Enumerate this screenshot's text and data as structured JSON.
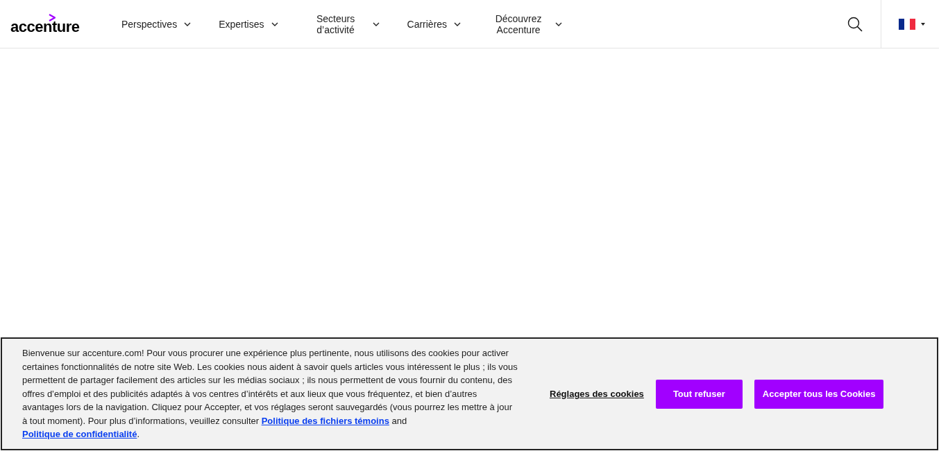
{
  "header": {
    "logo": "accenture",
    "nav": [
      {
        "label": "Perspectives"
      },
      {
        "label": "Expertises"
      },
      {
        "label": "Secteurs d’activité"
      },
      {
        "label": "Carrières"
      },
      {
        "label": "Découvrez Accenture"
      }
    ]
  },
  "cookie_banner": {
    "notice": [
      {
        "kind": "text",
        "text": "Bienvenue sur accenture.com! Pour vous procurer une expérience plus pertinente, nous utilisons des cookies pour activer certaines fonctionnalités de notre site Web. Les cookies nous aident à savoir quels articles vous intéressent le plus ; ils vous permettent de partager facilement des articles sur les médias sociaux ; ils nous permettent de vous fournir du contenu, des offres d’emploi et des publicités adaptés à vos centres d’intérêts et aux lieux que vous fréquentez, et bien d’autres avantages lors de la navigation. Cliquez pour Accepter, et vos réglages seront sauvegardés (vous pourrez les mettre à jour à tout moment). Pour plus d’informations, veuillez consulter "
      },
      {
        "kind": "link",
        "text": "Politique des fichiers témoins"
      },
      {
        "kind": "text",
        "text": " and "
      },
      {
        "kind": "link",
        "text": "Politique de confidentialité"
      },
      {
        "kind": "text",
        "text": "."
      }
    ],
    "settings_link": "Réglages des cookies",
    "buttons": [
      "Tout refuser",
      "Accepter tous les Cookies"
    ]
  }
}
